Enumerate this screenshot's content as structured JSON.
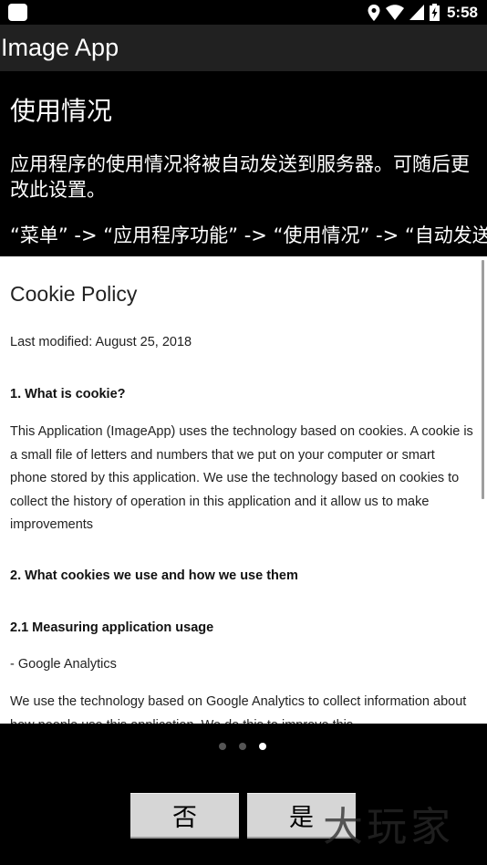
{
  "status_bar": {
    "time": "5:58",
    "icons": [
      "notification-icon",
      "location-icon",
      "wifi-icon",
      "signal-icon",
      "battery-charging-icon"
    ]
  },
  "app_bar": {
    "title": "Image App"
  },
  "usage": {
    "heading": "使用情况",
    "description": "应用程序的使用情况将被自动发送到服务器。可随后更改此设置。",
    "menu_path": "“菜单” -> “应用程序功能” -> “使用情况” -> “自动发送”"
  },
  "policy": {
    "title": "Cookie Policy",
    "last_modified": "Last modified: August 25, 2018",
    "section1_heading": "1. What is cookie?",
    "section1_body": "This Application (ImageApp) uses the technology based on cookies. A cookie is a small file of letters and numbers that we put on your computer or smart phone stored by this application. We use the technology based on cookies to collect the history of operation in this application and it allow us to make improvements",
    "section2_heading": "2. What cookies we use and how we use them",
    "section21_heading": "2.1 Measuring application usage",
    "section21_item": "- Google Analytics",
    "section21_body": "We use the technology based on Google Analytics to collect information about how people use this application. We do this to improve this"
  },
  "pager": {
    "count": 3,
    "active_index": 2
  },
  "buttons": {
    "no_label": "否",
    "yes_label": "是"
  },
  "watermark": "大玩家",
  "colors": {
    "app_bar": "#212121",
    "background": "#000000",
    "button": "#d6d6d6",
    "page": "#ffffff"
  }
}
